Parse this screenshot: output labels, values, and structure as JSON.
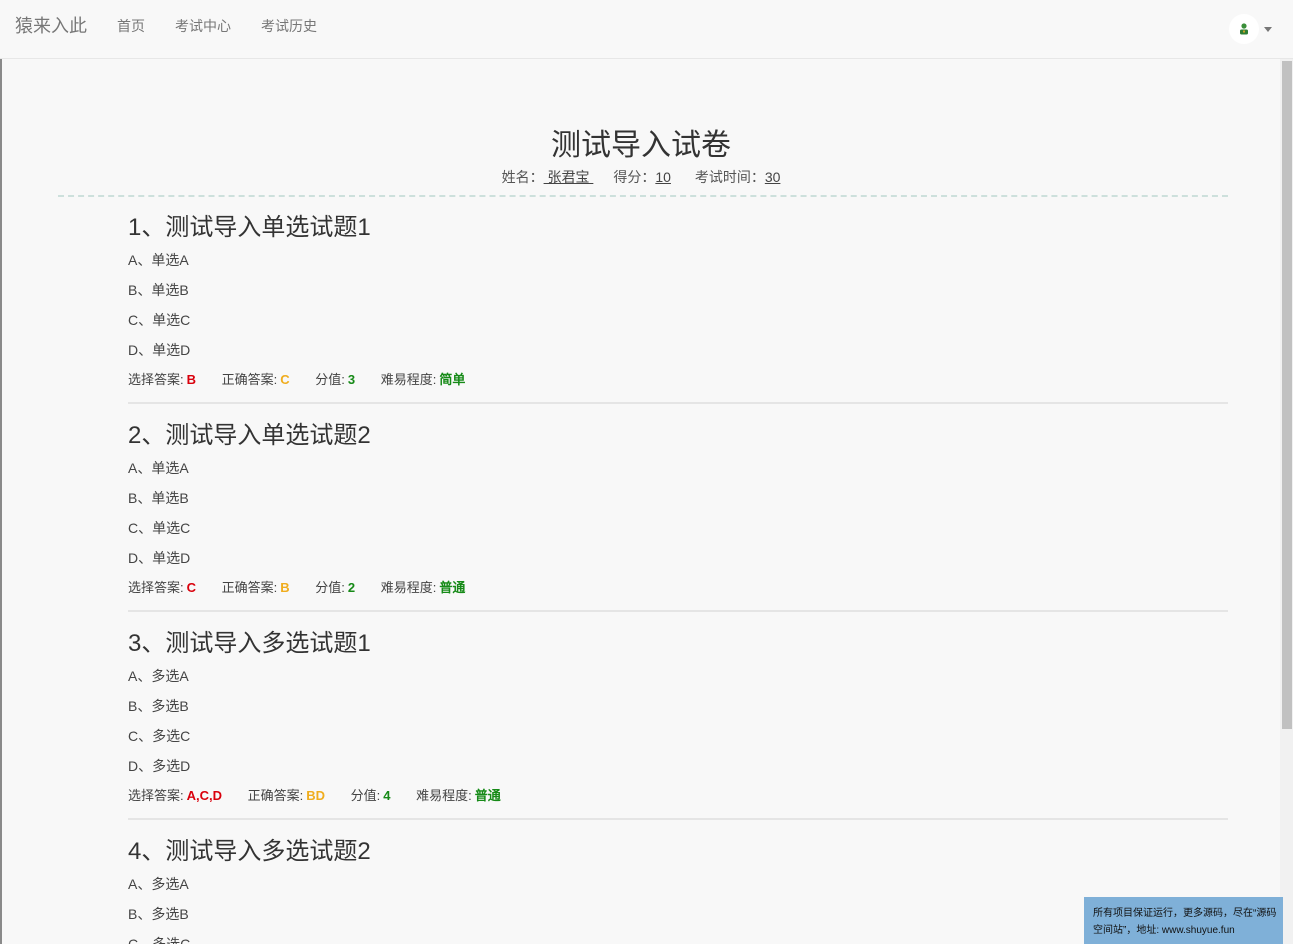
{
  "navbar": {
    "brand": "猿来入此",
    "items": [
      "首页",
      "考试中心",
      "考试历史"
    ],
    "avatar_icon": "user-avatar-icon"
  },
  "paper": {
    "title": "测试导入试卷",
    "name_label": "姓名：",
    "name_value": " 张君宝 ",
    "score_label": "得分：",
    "score_value": "10",
    "time_label": "考试时间：",
    "time_value": "30"
  },
  "meta_labels": {
    "selected": "选择答案:",
    "correct": "正确答案:",
    "points": "分值:",
    "difficulty": "难易程度:"
  },
  "questions": [
    {
      "title": "1、测试导入单选试题1",
      "options": [
        "A、单选A",
        "B、单选B",
        "C、单选C",
        "D、单选D"
      ],
      "selected": "B",
      "correct": "C",
      "points": "3",
      "difficulty": "简单"
    },
    {
      "title": "2、测试导入单选试题2",
      "options": [
        "A、单选A",
        "B、单选B",
        "C、单选C",
        "D、单选D"
      ],
      "selected": "C",
      "correct": "B",
      "points": "2",
      "difficulty": "普通"
    },
    {
      "title": "3、测试导入多选试题1",
      "options": [
        "A、多选A",
        "B、多选B",
        "C、多选C",
        "D、多选D"
      ],
      "selected": "A,C,D",
      "correct": "BD",
      "points": "4",
      "difficulty": "普通"
    },
    {
      "title": "4、测试导入多选试题2",
      "options": [
        "A、多选A",
        "B、多选B",
        "C、多选C"
      ]
    }
  ],
  "banner": {
    "line1": "所有项目保证运行，更多源码，尽在“源码",
    "line2": "空间站”，地址: www.shuyue.fun"
  },
  "colors": {
    "selected": "#d9000c",
    "correct": "#f0ad1e",
    "points": "#168a17",
    "difficulty": "#168a17",
    "banner_bg": "#7fb0d8"
  }
}
